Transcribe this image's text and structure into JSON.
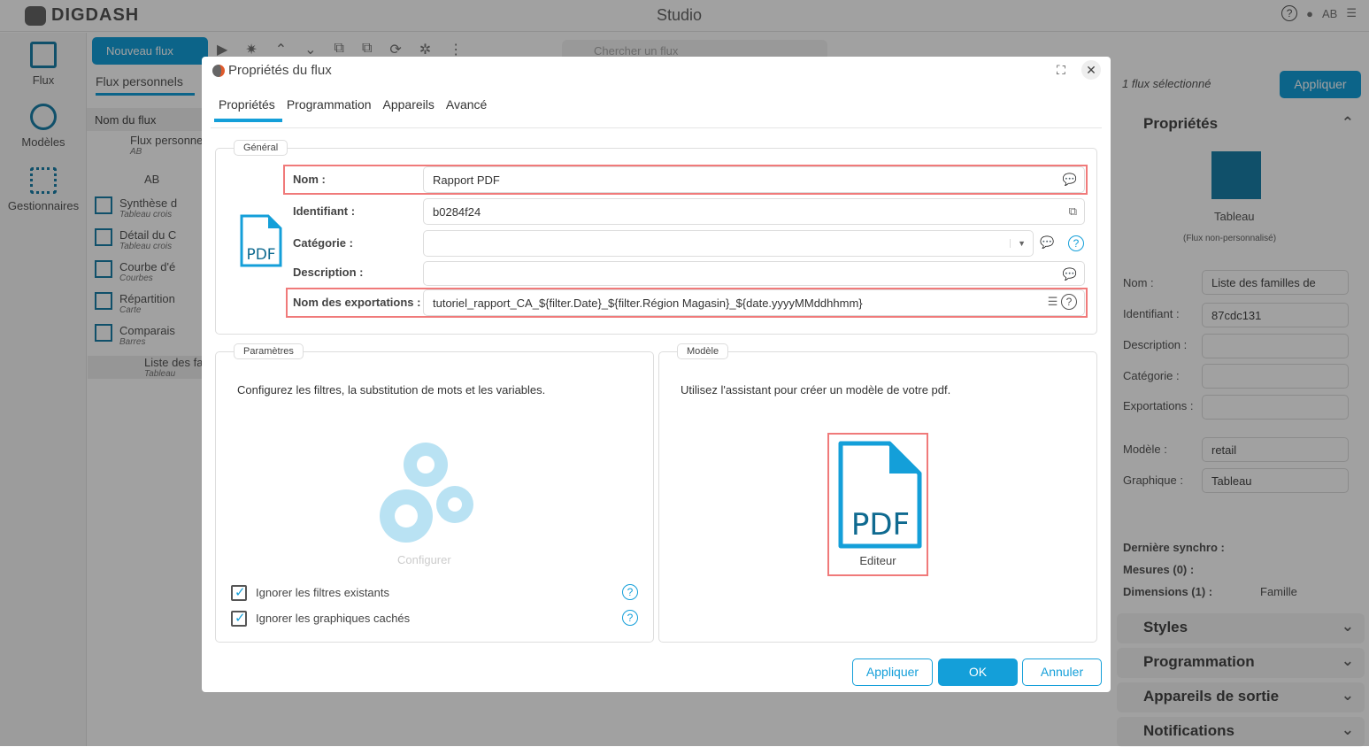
{
  "app": {
    "logo": "DIGDASH",
    "title": "Studio",
    "user": "AB"
  },
  "nav": [
    {
      "label": "Flux"
    },
    {
      "label": "Modèles"
    },
    {
      "label": "Gestionnaires"
    }
  ],
  "flows": {
    "new_button": "Nouveau flux",
    "tab": "Flux personnels",
    "column": "Nom du flux",
    "search_placeholder": "Chercher un flux",
    "items": [
      {
        "name": "Flux personnels",
        "sub": "AB"
      },
      {
        "name": "AB",
        "sub": ""
      },
      {
        "name": "Synthèse d",
        "sub": "Tableau crois"
      },
      {
        "name": "Détail du C",
        "sub": "Tableau crois"
      },
      {
        "name": "Courbe d'é",
        "sub": "Courbes"
      },
      {
        "name": "Répartition",
        "sub": "Carte"
      },
      {
        "name": "Comparais",
        "sub": "Barres"
      },
      {
        "name": "Liste des fa",
        "sub": "Tableau"
      }
    ]
  },
  "right_panel": {
    "selected": "1 flux sélectionné",
    "apply": "Appliquer",
    "properties_title": "Propriétés",
    "chart_type": "Tableau",
    "chart_note": "(Flux non-personnalisé)",
    "fields": [
      {
        "label": "Nom :",
        "value": "Liste des familles de"
      },
      {
        "label": "Identifiant :",
        "value": "87cdc131"
      },
      {
        "label": "Description :",
        "value": ""
      },
      {
        "label": "Catégorie :",
        "value": ""
      },
      {
        "label": "Exportations :",
        "value": ""
      },
      {
        "label": "Modèle :",
        "value": "retail"
      },
      {
        "label": "Graphique :",
        "value": "Tableau"
      }
    ],
    "sync_label": "Dernière synchro :",
    "measures_label": "Mesures (0) :",
    "dimensions_label": "Dimensions (1) :",
    "dimensions_value": "Famille",
    "sections": [
      "Styles",
      "Programmation",
      "Appareils de sortie",
      "Notifications"
    ]
  },
  "modal": {
    "title": "Propriétés du flux",
    "tabs": [
      "Propriétés",
      "Programmation",
      "Appareils",
      "Avancé"
    ],
    "active_tab": "Propriétés",
    "general": {
      "legend": "Général",
      "icon_label": "PDF",
      "name_label": "Nom :",
      "name_value": "Rapport PDF",
      "id_label": "Identifiant :",
      "id_value": "b0284f24",
      "category_label": "Catégorie :",
      "category_value": "",
      "description_label": "Description :",
      "description_value": "",
      "exports_label": "Nom des exportations :",
      "exports_value": "tutoriel_rapport_CA_${filter.Date}_${filter.Région Magasin}_${date.yyyyMMddhhmm}"
    },
    "params": {
      "legend": "Paramètres",
      "text": "Configurez les filtres, la substitution de mots et les variables.",
      "configure": "Configurer",
      "checkboxes": [
        {
          "label": "Ignorer les filtres existants",
          "checked": true
        },
        {
          "label": "Ignorer les graphiques cachés",
          "checked": true
        }
      ]
    },
    "model": {
      "legend": "Modèle",
      "text": "Utilisez l'assistant pour créer un modèle de votre pdf.",
      "icon_label": "PDF",
      "editor": "Editeur"
    },
    "buttons": {
      "apply": "Appliquer",
      "ok": "OK",
      "cancel": "Annuler"
    }
  },
  "colors": {
    "accent": "#149fd9",
    "highlight": "#f07a7a"
  }
}
